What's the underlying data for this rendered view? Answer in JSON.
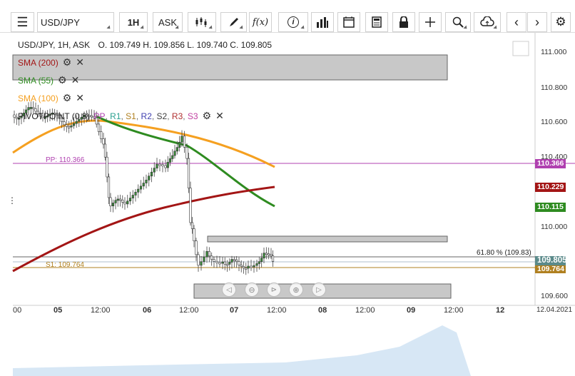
{
  "toolbar": {
    "symbol": "USD/JPY",
    "timeframe": "1H",
    "price_type": "ASK",
    "fx_label": "f(x)"
  },
  "chart_info": {
    "header": "USD/JPY, 1H, ASK",
    "ohlc": "O. 109.749 H. 109.856 L. 109.740 C. 109.805"
  },
  "indicators": [
    {
      "label": "SMA (200)",
      "color": "#a31515"
    },
    {
      "label": "SMA (55)",
      "color": "#2e8b20"
    },
    {
      "label": "SMA (100)",
      "color": "#f5a020"
    }
  ],
  "pivot": {
    "label": "PIVOTPOINT (0.8)",
    "levels": [
      {
        "label": "PP",
        "color": "#b040b0"
      },
      {
        "label": "R1",
        "color": "#2aa090"
      },
      {
        "label": "S1",
        "color": "#b08020"
      },
      {
        "label": "R2",
        "color": "#4040b0"
      },
      {
        "label": "S2",
        "color": "#404040"
      },
      {
        "label": "R3",
        "color": "#b03030"
      },
      {
        "label": "S3",
        "color": "#c040a0"
      }
    ],
    "pp_line_label": "PP: 110.366",
    "s1_line_label": "S1: 109.764"
  },
  "fib_label": "61.80 % (109.83)",
  "price_axis": [
    "111.000",
    "110.800",
    "110.600",
    "110.400",
    "110.000",
    "109.600"
  ],
  "price_tags": [
    {
      "label": "110.366",
      "color": "#b040b0"
    },
    {
      "label": "110.229",
      "color": "#a31515"
    },
    {
      "label": "110.115",
      "color": "#2e8b20"
    },
    {
      "label": "109.805",
      "color": "#5a8a8a"
    },
    {
      "label": "109.764",
      "color": "#b08020"
    }
  ],
  "time_axis": [
    "00",
    "05",
    "12:00",
    "06",
    "12:00",
    "07",
    "12:00",
    "08",
    "12:00",
    "09",
    "12:00",
    "12",
    "12.04.2021"
  ]
}
